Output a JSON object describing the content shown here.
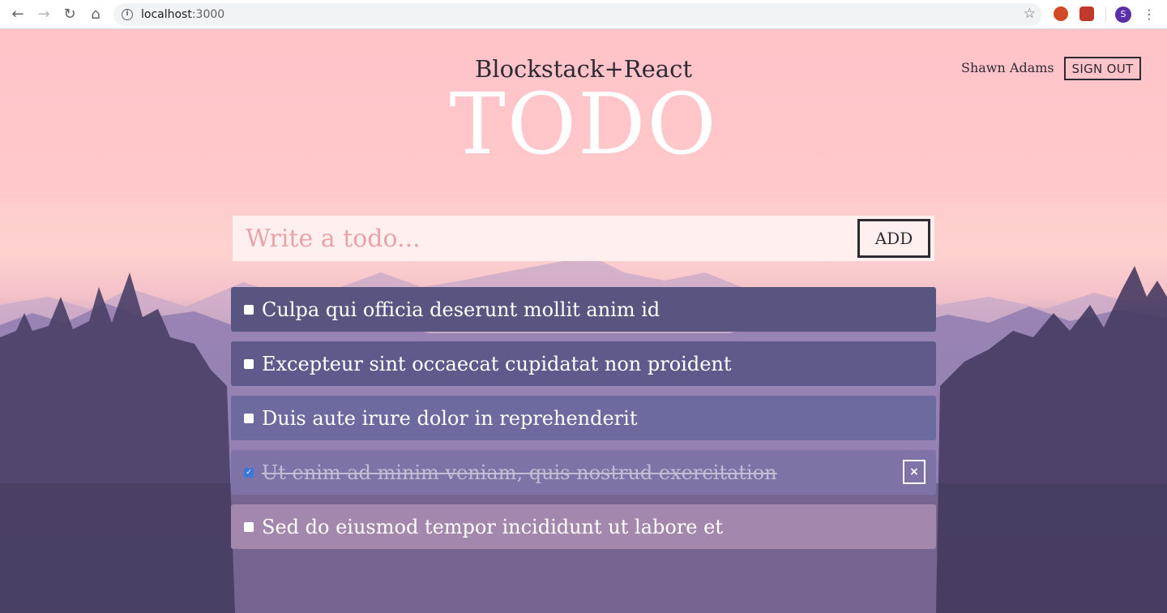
{
  "browser": {
    "url_host": "localhost",
    "url_port": ":3000",
    "back_icon": "arrow-left-icon",
    "forward_icon": "arrow-right-icon",
    "reload_icon": "reload-icon",
    "home_icon": "home-icon",
    "profile_initial": "S"
  },
  "header": {
    "user_name": "Shawn Adams",
    "sign_out_label": "SIGN OUT",
    "subtitle": "Blockstack+React",
    "title": "TODO"
  },
  "form": {
    "placeholder": "Write a todo...",
    "add_label": "ADD"
  },
  "todos": [
    {
      "text": "Culpa qui officia deserunt mollit anim id",
      "done": false,
      "color": "#585580"
    },
    {
      "text": "Excepteur sint occaecat cupidatat non proident",
      "done": false,
      "color": "#605a8c"
    },
    {
      "text": "Duis aute irure dolor in reprehenderit",
      "done": false,
      "color": "#6c6a9e"
    },
    {
      "text": "Ut enim ad minim veniam, quis nostrud exercitation",
      "done": true,
      "color": "#7e72a6",
      "remove_label": "×"
    },
    {
      "text": "Sed do eiusmod tempor incididunt ut labore et",
      "done": false,
      "color": "#a487ac"
    }
  ]
}
